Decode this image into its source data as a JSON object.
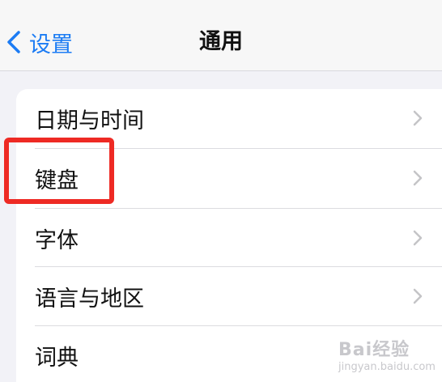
{
  "nav": {
    "back_label": "设置",
    "back_icon": "chevron-left-icon",
    "title": "通用"
  },
  "settings": {
    "items": [
      {
        "label": "日期与时间",
        "icon": "chevron-right-icon"
      },
      {
        "label": "键盘",
        "icon": "chevron-right-icon"
      },
      {
        "label": "字体",
        "icon": "chevron-right-icon"
      },
      {
        "label": "语言与地区",
        "icon": "chevron-right-icon"
      },
      {
        "label": "词典",
        "icon": "chevron-right-icon"
      }
    ]
  },
  "annotation": {
    "highlight_color": "#ee2a24",
    "highlighted_item": "键盘"
  },
  "watermark": {
    "brand": "Bai经验",
    "url": "jingyan.baidu.com"
  },
  "colors": {
    "accent": "#1c7cf4",
    "background": "#f2f2f7"
  }
}
